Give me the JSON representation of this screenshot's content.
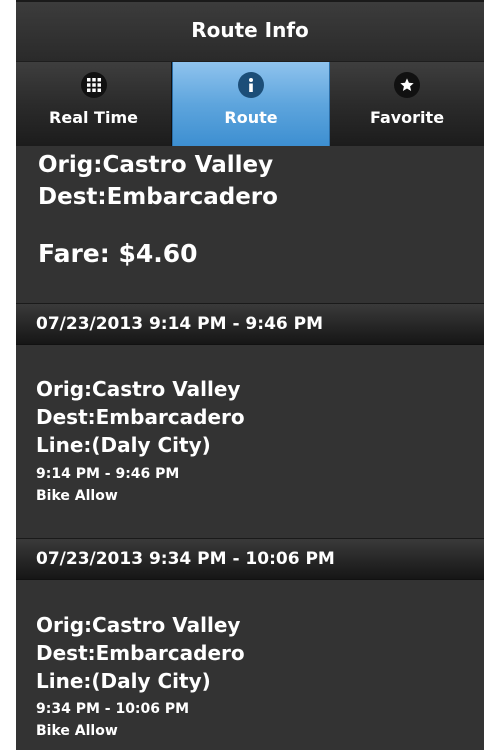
{
  "header": {
    "title": "Route Info"
  },
  "tabs": [
    {
      "label": "Real Time",
      "icon": "grid-icon"
    },
    {
      "label": "Route",
      "icon": "info-icon",
      "active": true
    },
    {
      "label": "Favorite",
      "icon": "star-icon"
    }
  ],
  "summary": {
    "orig": "Orig:Castro Valley",
    "dest": "Dest:Embarcadero",
    "fare": "Fare: $4.60"
  },
  "trips": [
    {
      "header": "07/23/2013 9:14 PM - 9:46 PM",
      "orig": "Orig:Castro Valley",
      "dest": "Dest:Embarcadero",
      "line": "Line:(Daly City)",
      "time": "9:14 PM - 9:46 PM",
      "bike": "Bike Allow"
    },
    {
      "header": "07/23/2013 9:34 PM - 10:06 PM",
      "orig": "Orig:Castro Valley",
      "dest": "Dest:Embarcadero",
      "line": "Line:(Daly City)",
      "time": "9:34 PM - 10:06 PM",
      "bike": "Bike Allow"
    }
  ],
  "colors": {
    "background": "#333333",
    "active_tab": "#5ea5dd",
    "text": "#ffffff"
  }
}
